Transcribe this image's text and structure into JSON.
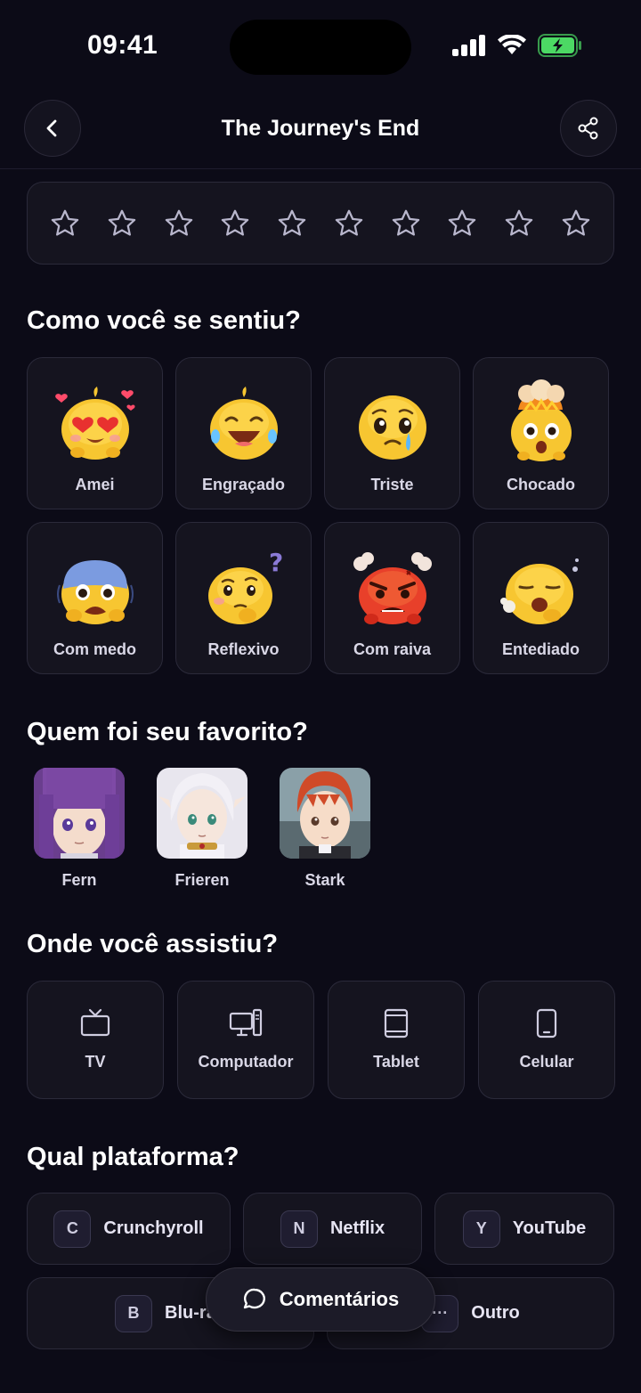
{
  "status_bar": {
    "time": "09:41"
  },
  "header": {
    "title": "The Journey's End"
  },
  "rating": {
    "max_stars": 10,
    "selected": 0
  },
  "emotions": {
    "title": "Como você se sentiu?",
    "items": [
      {
        "label": "Amei",
        "icon": "heart-eyes-emoji-icon"
      },
      {
        "label": "Engraçado",
        "icon": "laughing-emoji-icon"
      },
      {
        "label": "Triste",
        "icon": "crying-emoji-icon"
      },
      {
        "label": "Chocado",
        "icon": "shocked-emoji-icon"
      },
      {
        "label": "Com medo",
        "icon": "scared-emoji-icon"
      },
      {
        "label": "Reflexivo",
        "icon": "thinking-emoji-icon"
      },
      {
        "label": "Com raiva",
        "icon": "angry-emoji-icon"
      },
      {
        "label": "Entediado",
        "icon": "bored-emoji-icon"
      }
    ]
  },
  "favorites": {
    "title": "Quem foi seu favorito?",
    "items": [
      {
        "name": "Fern"
      },
      {
        "name": "Frieren"
      },
      {
        "name": "Stark"
      }
    ]
  },
  "devices": {
    "title": "Onde você assistiu?",
    "items": [
      {
        "label": "TV",
        "icon": "tv-icon"
      },
      {
        "label": "Computador",
        "icon": "computer-icon"
      },
      {
        "label": "Tablet",
        "icon": "tablet-icon"
      },
      {
        "label": "Celular",
        "icon": "phone-icon"
      }
    ]
  },
  "platforms": {
    "title": "Qual plataforma?",
    "items": [
      {
        "badge": "C",
        "name": "Crunchyroll"
      },
      {
        "badge": "N",
        "name": "Netflix"
      },
      {
        "badge": "Y",
        "name": "YouTube"
      },
      {
        "badge": "B",
        "name": "Blu-ray"
      },
      {
        "badge": "···",
        "name": "Outro"
      }
    ]
  },
  "comments": {
    "label": "Comentários"
  },
  "colors": {
    "background": "#0c0b17",
    "card": "#15141f",
    "border": "#2b2a3a",
    "battery": "#4cd964"
  }
}
